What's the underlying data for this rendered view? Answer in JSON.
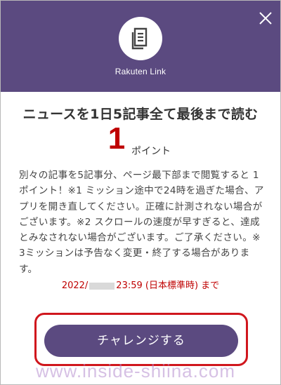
{
  "colors": {
    "header_bg": "#5b4a80",
    "accent_red": "#bf0000",
    "highlight_red": "#d0161d",
    "button_bg": "#5b4a80"
  },
  "header": {
    "close_icon": "close-icon",
    "logo_icon": "news-article-icon",
    "app_name": "Rakuten Link"
  },
  "mission": {
    "title": "ニュースを1日5記事全て最後まで読む",
    "points_value": "1",
    "points_unit": "ポイント",
    "description": "別々の記事を5記事分、ページ最下部まで閲覧すると 1ポイント！※1 ミッション途中で24時を過ぎた場合、アプリを開き直してください。正確に計測されない場合がございます。※2 スクロールの速度が早すぎると、達成とみなされない場合がございます。ご了承ください。※3ミッションは予告なく変更・終了する場合があります。",
    "deadline_prefix": "2022/",
    "deadline_suffix": "23:59 (日本標準時) まで"
  },
  "actions": {
    "challenge_label": "チャレンジする"
  },
  "watermark": "www.inside-shiina.com"
}
